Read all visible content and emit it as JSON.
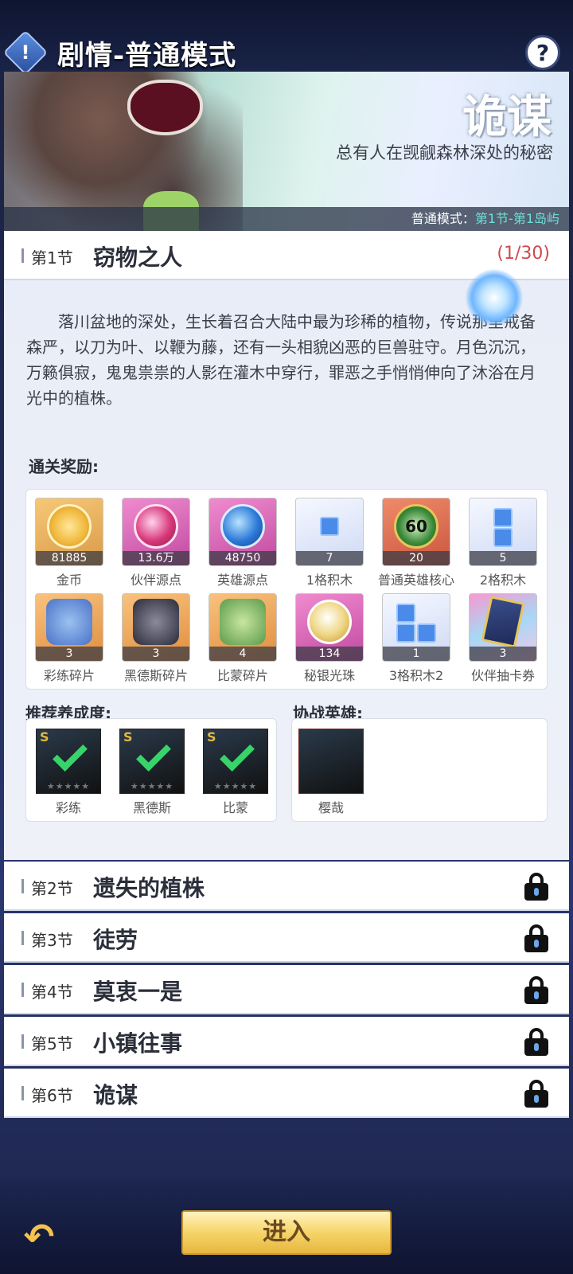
{
  "header": {
    "title": "剧情-普通模式",
    "info_icon": "!",
    "help_icon": "?"
  },
  "banner": {
    "title": "诡谋",
    "subtitle": "总有人在觊觎森林深处的秘密",
    "mode_label": "普通模式：",
    "mode_value": "第1节-第1岛屿"
  },
  "chapters": [
    {
      "num": "第1节",
      "name": "窃物之人",
      "progress": "(1/30)"
    },
    {
      "num": "第2节",
      "name": "遗失的植株"
    },
    {
      "num": "第3节",
      "name": "徒劳"
    },
    {
      "num": "第4节",
      "name": "莫衷一是"
    },
    {
      "num": "第5节",
      "name": "小镇往事"
    },
    {
      "num": "第6节",
      "name": "诡谋"
    }
  ],
  "story": "落川盆地的深处，生长着召合大陆中最为珍稀的植物，传说那里戒备森严，以刀为叶、以鞭为藤，还有一头相貌凶恶的巨兽驻守。月色沉沉，万籁俱寂，鬼鬼祟祟的人影在灌木中穿行，罪恶之手悄悄伸向了沐浴在月光中的植株。",
  "rewards_label": "通关奖励:",
  "rewards": [
    {
      "count": "81885",
      "label": "金币"
    },
    {
      "count": "13.6万",
      "label": "伙伴源点"
    },
    {
      "count": "48750",
      "label": "英雄源点"
    },
    {
      "count": "7",
      "label": "1格积木"
    },
    {
      "count": "20",
      "label": "普通英雄核心",
      "badge": "60"
    },
    {
      "count": "5",
      "label": "2格积木"
    },
    {
      "count": "3",
      "label": "彩练碎片"
    },
    {
      "count": "3",
      "label": "黑德斯碎片"
    },
    {
      "count": "4",
      "label": "比蒙碎片"
    },
    {
      "count": "134",
      "label": "秘银光珠"
    },
    {
      "count": "1",
      "label": "3格积木2"
    },
    {
      "count": "3",
      "label": "伙伴抽卡券"
    }
  ],
  "recommended_label": "推荐养成度:",
  "recommended": [
    {
      "name": "彩练",
      "rank": "S",
      "stars": "★★★★★"
    },
    {
      "name": "黑德斯",
      "rank": "S",
      "stars": "★★★★★"
    },
    {
      "name": "比蒙",
      "rank": "S",
      "stars": "★★★★★"
    }
  ],
  "ally_label": "协战英雄:",
  "allies": [
    {
      "name": "樱哉"
    }
  ],
  "footer": {
    "back_icon": "↶",
    "enter_label": "进入"
  }
}
